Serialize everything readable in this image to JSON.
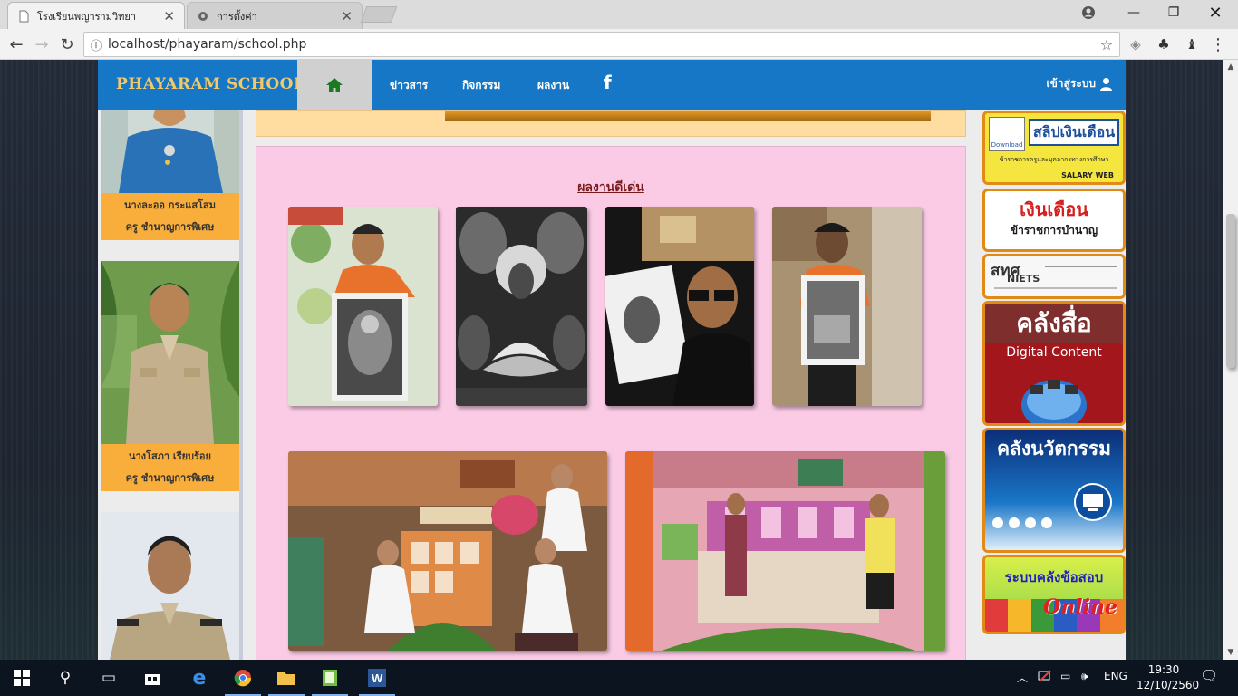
{
  "browser": {
    "tabs": [
      {
        "title": "โรงเรียนพญารามวิทยา",
        "active": true
      },
      {
        "title": "การตั้งค่า",
        "active": false
      }
    ],
    "url": "localhost/phayaram/school.php"
  },
  "site": {
    "brand": "PHAYARAM SCHOOL",
    "nav": [
      "ข่าวสาร",
      "กิจกรรม",
      "ผลงาน"
    ],
    "facebook_glyph": "f",
    "login": "เข้าสู่ระบบ"
  },
  "teachers": [
    {
      "name": "นางละออ  กระแสโสม",
      "position": "ครู ชำนาญการพิเศษ"
    },
    {
      "name": "นางโสภา  เรียบร้อย",
      "position": "ครู ชำนาญการพิเศษ"
    }
  ],
  "works": {
    "title": "ผลงานดีเด่น"
  },
  "banners": {
    "salary": {
      "title": "สลิปเงินเดือน",
      "subtitle": "ข้าราชการครูและบุคลากรทางการศึกษา",
      "tag": "SALARY WEB",
      "download": "Download"
    },
    "pension": {
      "line1": "เงินเดือน",
      "line2": "ข้าราชการบำนาญ"
    },
    "niets": {
      "title": "สทศ",
      "sub": "NIETS"
    },
    "digital": {
      "title": "คลังสื่อ",
      "sub": "Digital Content"
    },
    "innovation": {
      "title": "คลังนวัตกรรม"
    },
    "exam": {
      "title": "ระบบคลังข้อสอบ",
      "sub": "Online"
    }
  },
  "taskbar": {
    "lang": "ENG",
    "time": "19:30",
    "date": "12/10/2560"
  },
  "colors": {
    "navbar": "#1577c6",
    "brand": "#f3c86a",
    "caption": "#f9ae3b",
    "works_bg": "#fbcbe6",
    "banner_border": "#e28a16"
  }
}
